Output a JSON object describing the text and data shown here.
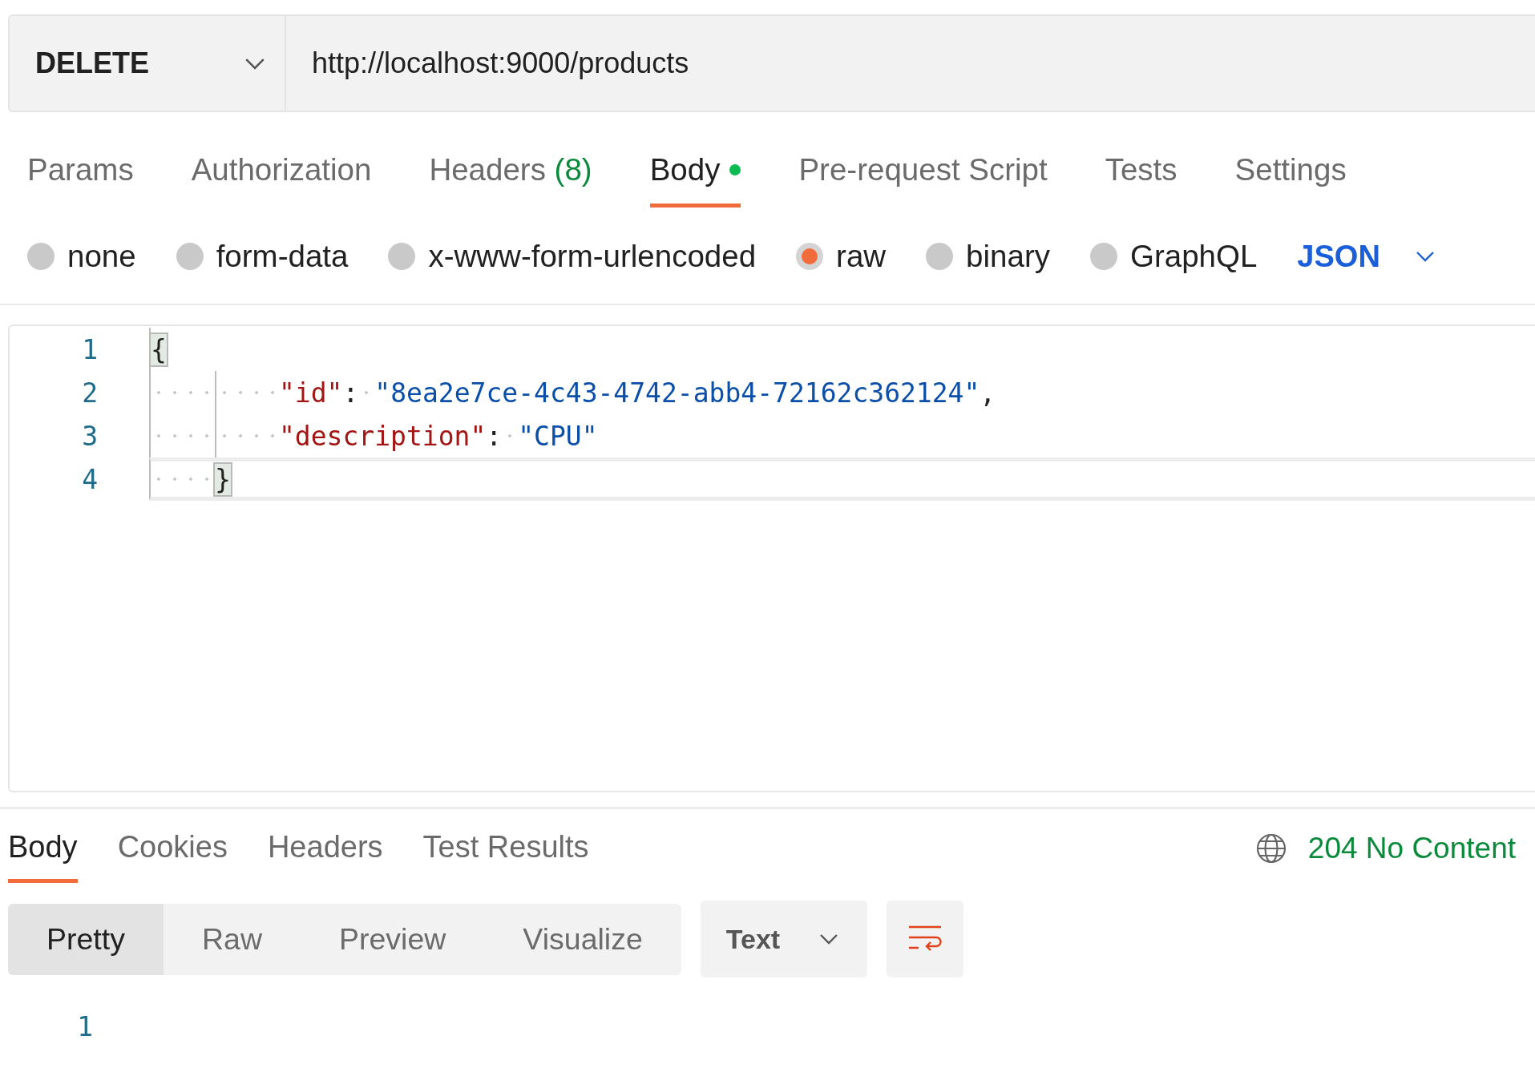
{
  "request": {
    "method": "DELETE",
    "url": "http://localhost:9000/products"
  },
  "request_tabs": [
    {
      "label": "Params",
      "selected": false
    },
    {
      "label": "Authorization",
      "selected": false
    },
    {
      "label": "Headers",
      "count": "(8)",
      "selected": false
    },
    {
      "label": "Body",
      "dot": true,
      "selected": true
    },
    {
      "label": "Pre-request Script",
      "selected": false
    },
    {
      "label": "Tests",
      "selected": false
    },
    {
      "label": "Settings",
      "selected": false
    }
  ],
  "body_types": [
    {
      "label": "none",
      "selected": false
    },
    {
      "label": "form-data",
      "selected": false
    },
    {
      "label": "x-www-form-urlencoded",
      "selected": false
    },
    {
      "label": "raw",
      "selected": true
    },
    {
      "label": "binary",
      "selected": false
    },
    {
      "label": "GraphQL",
      "selected": false
    }
  ],
  "body_format": "JSON",
  "editor": {
    "lines": [
      {
        "number": "1",
        "active": false,
        "tokens": [
          {
            "kind": "brace",
            "text": "{",
            "matched": true
          }
        ]
      },
      {
        "number": "2",
        "active": false,
        "tokens": [
          {
            "kind": "indent"
          },
          {
            "kind": "indent"
          },
          {
            "kind": "key",
            "text": "\"id\""
          },
          {
            "kind": "punct",
            "text": ":"
          },
          {
            "kind": "space"
          },
          {
            "kind": "string",
            "text": "\"8ea2e7ce-4c43-4742-abb4-72162c362124\""
          },
          {
            "kind": "punct",
            "text": ","
          }
        ]
      },
      {
        "number": "3",
        "active": false,
        "tokens": [
          {
            "kind": "indent"
          },
          {
            "kind": "indent"
          },
          {
            "kind": "key",
            "text": "\"description\""
          },
          {
            "kind": "punct",
            "text": ":"
          },
          {
            "kind": "space"
          },
          {
            "kind": "string",
            "text": "\"CPU\""
          }
        ]
      },
      {
        "number": "4",
        "active": true,
        "tokens": [
          {
            "kind": "indent"
          },
          {
            "kind": "brace",
            "text": "}",
            "matched": true
          }
        ]
      }
    ]
  },
  "response": {
    "tabs": [
      {
        "label": "Body",
        "selected": true
      },
      {
        "label": "Cookies",
        "selected": false
      },
      {
        "label": "Headers",
        "selected": false
      },
      {
        "label": "Test Results",
        "selected": false
      }
    ],
    "status": "204 No Content",
    "view_modes": [
      {
        "label": "Pretty",
        "selected": true
      },
      {
        "label": "Raw",
        "selected": false
      },
      {
        "label": "Preview",
        "selected": false
      },
      {
        "label": "Visualize",
        "selected": false
      }
    ],
    "format": "Text",
    "line_numbers": [
      "1"
    ]
  }
}
